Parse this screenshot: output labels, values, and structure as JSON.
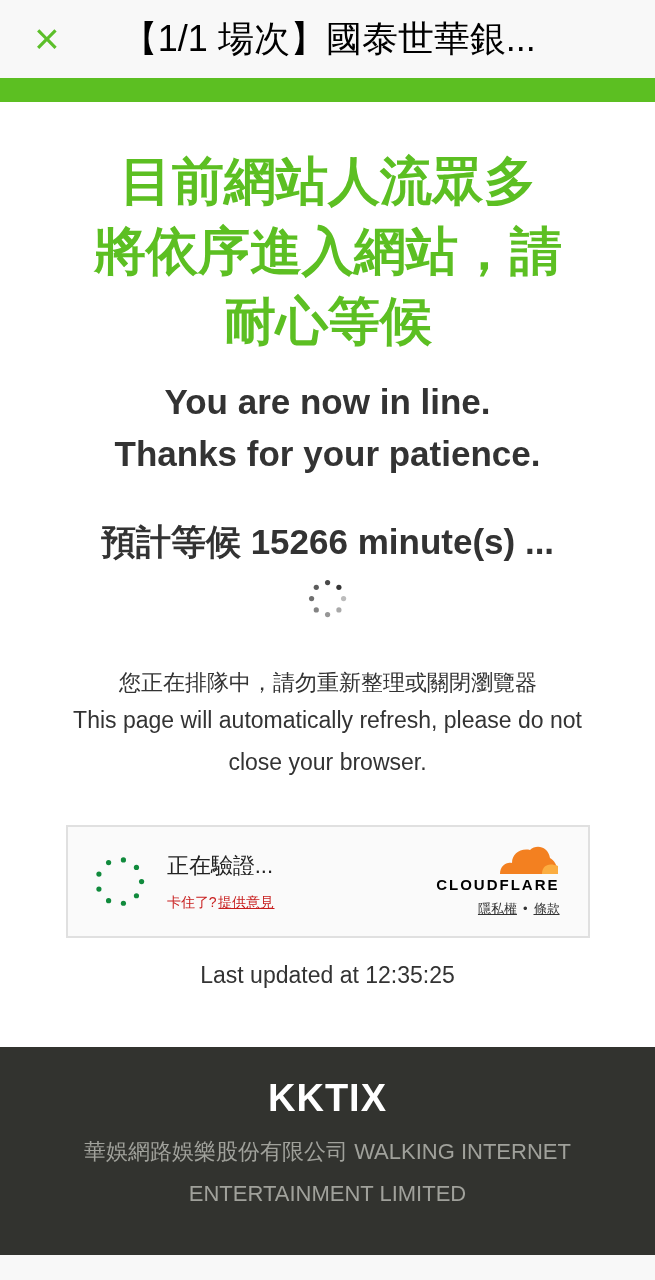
{
  "header": {
    "close": "×",
    "title": "【1/1 場次】國泰世華銀..."
  },
  "headline": {
    "zh_lines": [
      "目前網站人流眾多",
      "將依序進入網站，請耐心等候"
    ],
    "en_lines": [
      "You are now in line.",
      "Thanks for your patience."
    ]
  },
  "wait": "預計等候 15266 minute(s) ...",
  "notice": {
    "zh": "您正在排隊中，請勿重新整理或關閉瀏覽器",
    "en": "This page will automatically refresh, please do not close your browser."
  },
  "verify": {
    "status": "正在驗證...",
    "stuck": "卡住了?",
    "feedback": "提供意見",
    "brand": "CLOUDFLARE",
    "privacy": "隱私權",
    "separator": "•",
    "terms": "條款"
  },
  "last_updated": "Last updated at 12:35:25",
  "footer": {
    "logo": "KKTIX",
    "company": "華娛網路娛樂股份有限公司 WALKING INTERNET ENTERTAINMENT LIMITED"
  }
}
